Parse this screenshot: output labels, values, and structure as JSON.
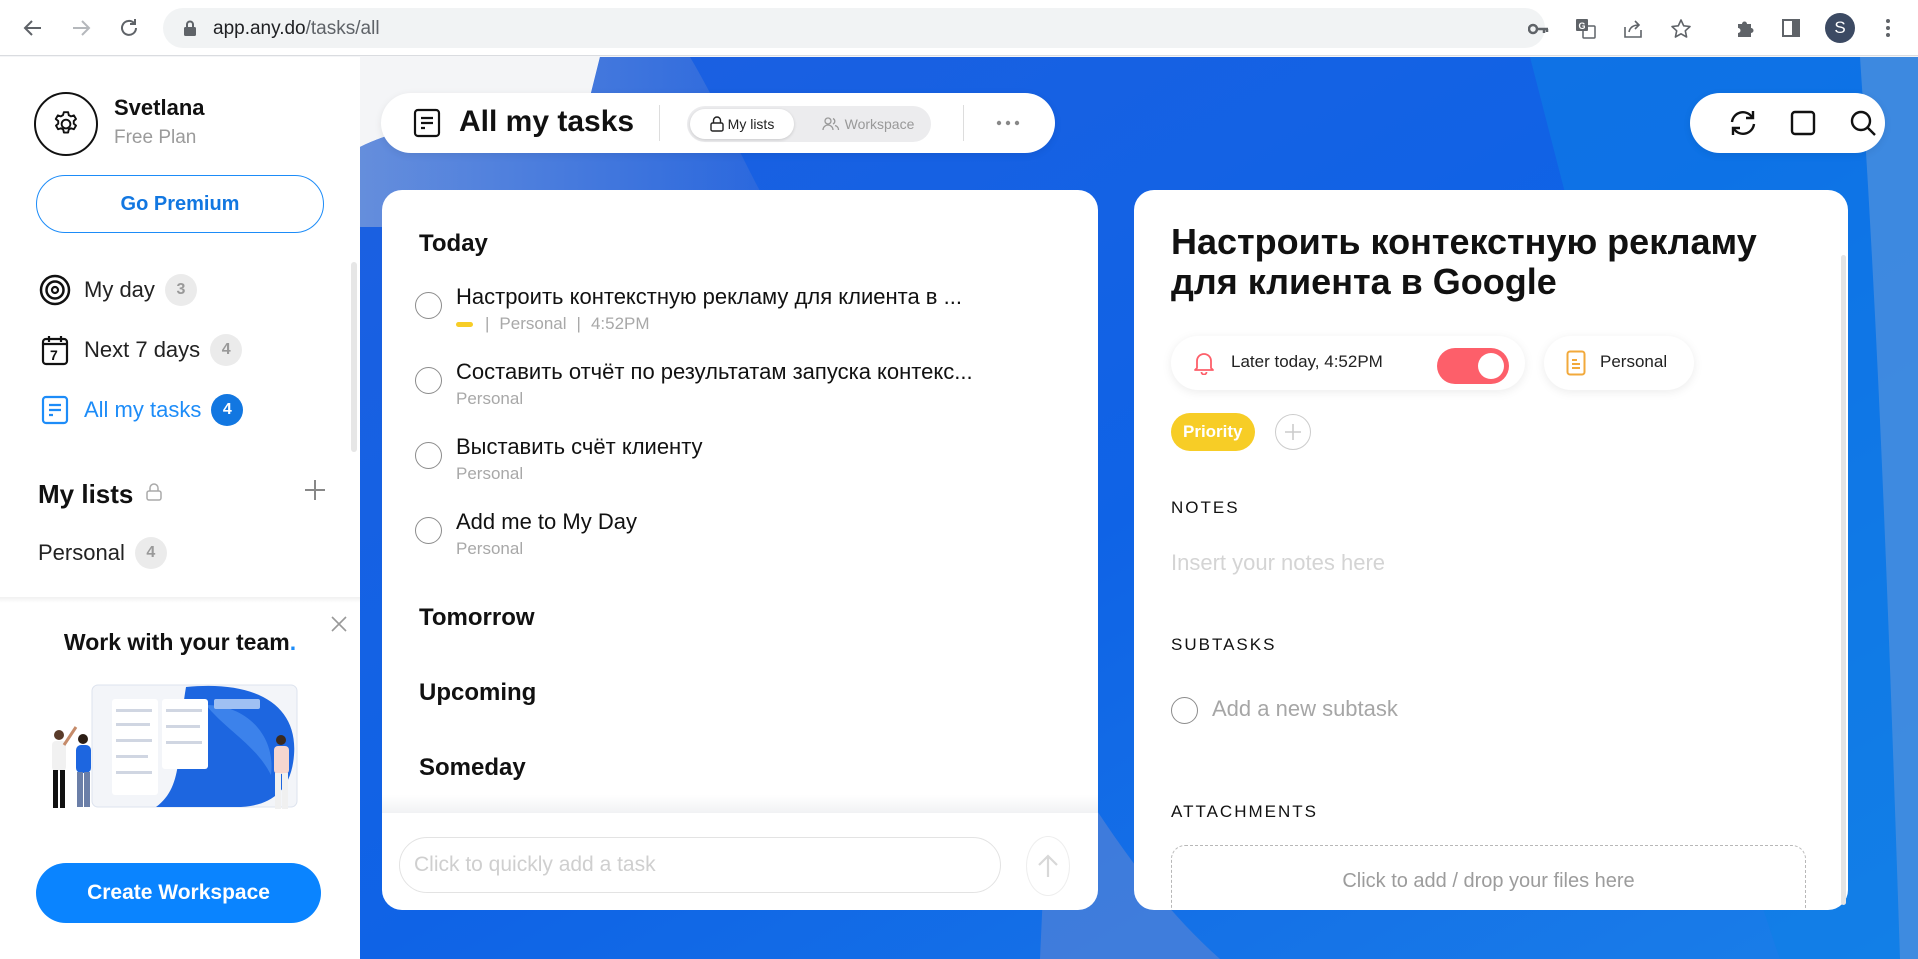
{
  "browser": {
    "url_domain": "app.any.do",
    "url_path": "/tasks/all",
    "profile_initial": "S"
  },
  "sidebar": {
    "user_name": "Svetlana",
    "plan": "Free Plan",
    "premium_label": "Go Premium",
    "nav": [
      {
        "label": "My day",
        "count": "3",
        "icon": "target-icon"
      },
      {
        "label": "Next 7 days",
        "count": "4",
        "icon": "calendar-7-icon"
      },
      {
        "label": "All my tasks",
        "count": "4",
        "icon": "list-icon",
        "active": true
      }
    ],
    "lists_heading": "My lists",
    "lists": [
      {
        "label": "Personal",
        "count": "4"
      }
    ],
    "promo": {
      "title": "Work with your team",
      "title_dot": ".",
      "button_label": "Create Workspace"
    }
  },
  "header": {
    "title": "All my tasks",
    "seg_my_lists": "My lists",
    "seg_workspace": "Workspace"
  },
  "tasks": {
    "sections": [
      "Today",
      "Tomorrow",
      "Upcoming",
      "Someday"
    ],
    "today": [
      {
        "title": "Настроить контекстную рекламу для клиента в ...",
        "list": "Personal",
        "time": "4:52PM",
        "priority": true
      },
      {
        "title": "Составить отчёт по результатам запуска контекс...",
        "list": "Personal"
      },
      {
        "title": "Выставить счёт клиенту",
        "list": "Personal"
      },
      {
        "title": "Add me to My Day",
        "list": "Personal"
      }
    ],
    "quick_add_placeholder": "Click to quickly add a task",
    "meta_separator": "|"
  },
  "detail": {
    "title": "Настроить контекстную рекламу для клиента в Google",
    "reminder": "Later today, 4:52PM",
    "reminder_enabled": true,
    "list": "Personal",
    "tag": "Priority",
    "notes_label": "NOTES",
    "notes_placeholder": "Insert your notes here",
    "subtasks_label": "SUBTASKS",
    "subtask_placeholder": "Add a new subtask",
    "attachments_label": "ATTACHMENTS",
    "dropzone_text": "Click to add / drop your files here"
  },
  "colors": {
    "accent": "#1d8cf8",
    "priority": "#f7cd26",
    "toggle_on": "#fd5f6a"
  }
}
